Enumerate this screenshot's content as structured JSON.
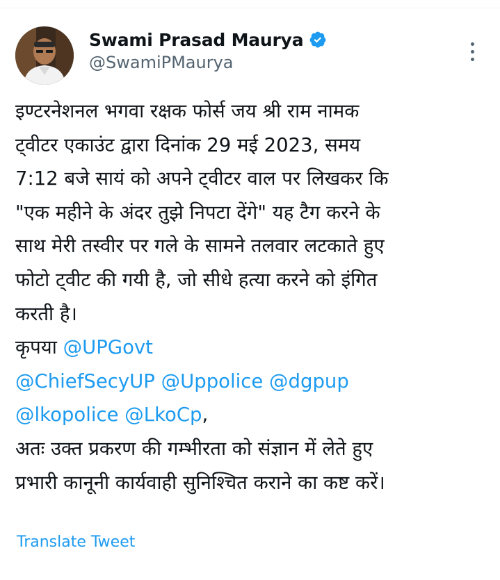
{
  "author": {
    "display_name": "Swami Prasad Maurya",
    "handle": "@SwamiPMaurya",
    "verified": true,
    "verified_color": "#1d9bf0"
  },
  "tweet": {
    "paragraph1_lines": [
      "इण्टरनेशनल भगवा रक्षक फोर्स जय श्री राम नामक",
      "ट्वीटर एकाउंट द्वारा दिनांक 29 मई 2023, समय",
      "7:12 बजे सायं को अपने ट्वीटर वाल पर लिखकर कि",
      "\"एक महीने के अंदर तुझे निपटा देंगे\" यह टैग करने के",
      "साथ मेरी तस्वीर पर गले के सामने तलवार लटकाते हुए",
      "फोटो ट्वीट की गयी है, जो सीधे हत्या करने को इंगित",
      "करती है।"
    ],
    "kripya_label": "कृपया",
    "mentions": {
      "upgovt": "@UPGovt",
      "chiefsecyup": "@ChiefSecyUP",
      "uppolice": "@Uppolice",
      "dgpup": "@dgpup",
      "lkopolice": "@lkopolice",
      "lkocp": "@LkoCp"
    },
    "comma": ",",
    "closing_lines": [
      "अतः उक्त प्रकरण की गम्भीरता को संज्ञान में लेते हुए",
      "प्रभारी कानूनी कार्यवाही सुनिश्चित कराने का कष्ट करें।"
    ]
  },
  "translate_label": "Translate Tweet",
  "colors": {
    "link": "#1d9bf0",
    "text": "#0f1419",
    "secondary": "#536471"
  },
  "icons": {
    "verified": "verified-badge-icon",
    "more": "more-options-icon"
  }
}
